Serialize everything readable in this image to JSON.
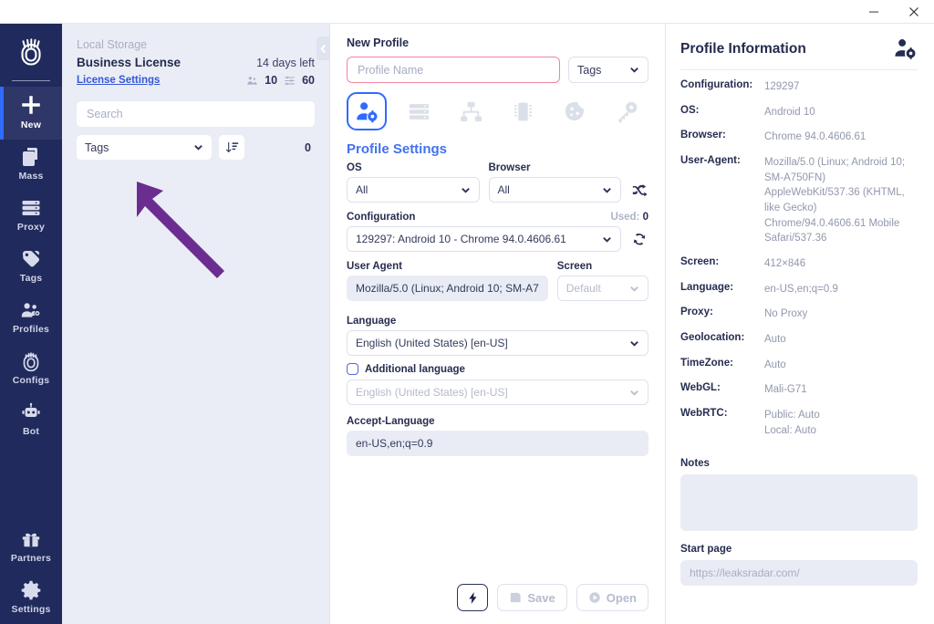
{
  "window": {
    "minimize_label": "minimize",
    "close_label": "close"
  },
  "sidebar": {
    "logo_name": "fingerprint-logo",
    "items": [
      {
        "label": "New",
        "icon": "plus-icon",
        "active": true
      },
      {
        "label": "Mass",
        "icon": "copy-icon",
        "active": false
      },
      {
        "label": "Proxy",
        "icon": "server-icon",
        "active": false
      },
      {
        "label": "Tags",
        "icon": "tag-icon",
        "active": false
      },
      {
        "label": "Profiles",
        "icon": "profiles-icon",
        "active": false
      },
      {
        "label": "Configs",
        "icon": "fingerprint-icon",
        "active": false
      },
      {
        "label": "Bot",
        "icon": "robot-icon",
        "active": false
      }
    ],
    "bottom_items": [
      {
        "label": "Partners",
        "icon": "gift-icon"
      },
      {
        "label": "Settings",
        "icon": "gear-icon"
      }
    ],
    "accent_color": "#2f6bff",
    "background_color": "#212a5c"
  },
  "list_panel": {
    "storage_label": "Local Storage",
    "license_name": "Business License",
    "days_left": "14 days left",
    "license_settings_link": "License Settings",
    "profiles_count": "10",
    "configs_count": "60",
    "search_placeholder": "Search",
    "tags_filter_label": "Tags",
    "sort_icon": "sort-descending-icon",
    "result_count": "0",
    "collapse_icon": "chevron-left-icon"
  },
  "annotation": {
    "type": "arrow",
    "color": "#6b2d8f",
    "points_to": "tags-filter-dropdown"
  },
  "center_panel": {
    "heading": "New Profile",
    "profile_name_placeholder": "Profile Name",
    "profile_name_value": "",
    "tags_label": "Tags",
    "tabs": [
      {
        "name": "profile-settings",
        "icon": "user-gear-icon",
        "active": true
      },
      {
        "name": "proxy",
        "icon": "server-icon",
        "active": false
      },
      {
        "name": "network",
        "icon": "sitemap-icon",
        "active": false
      },
      {
        "name": "hardware",
        "icon": "cpu-chip-icon",
        "active": false
      },
      {
        "name": "cookies",
        "icon": "cookie-icon",
        "active": false
      },
      {
        "name": "password",
        "icon": "key-icon",
        "active": false
      }
    ],
    "section_title": "Profile Settings",
    "os_label": "OS",
    "os_value": "All",
    "browser_label": "Browser",
    "browser_value": "All",
    "shuffle_icon": "shuffle-icon",
    "configuration_label": "Configuration",
    "used_label": "Used:",
    "used_value": "0",
    "configuration_value": "129297: Android 10 - Chrome 94.0.4606.61",
    "refresh_icon": "refresh-icon",
    "user_agent_label": "User Agent",
    "user_agent_value": "Mozilla/5.0 (Linux; Android 10; SM-A7",
    "screen_label": "Screen",
    "screen_value": "Default",
    "language_label": "Language",
    "language_value": "English (United States) [en-US]",
    "additional_language_label": "Additional language",
    "additional_language_value": "English (United States) [en-US]",
    "accept_language_label": "Accept-Language",
    "accept_language_value": "en-US,en;q=0.9",
    "flash_button_icon": "lightning-icon",
    "save_label": "Save",
    "open_label": "Open"
  },
  "right_panel": {
    "title": "Profile Information",
    "header_icon": "user-gear-icon",
    "info": [
      {
        "key": "Configuration:",
        "value": "129297"
      },
      {
        "key": "OS:",
        "value": "Android 10"
      },
      {
        "key": "Browser:",
        "value": "Chrome 94.0.4606.61"
      },
      {
        "key": "User-Agent:",
        "value": "Mozilla/5.0 (Linux; Android 10; SM-A750FN) AppleWebKit/537.36 (KHTML, like Gecko) Chrome/94.0.4606.61 Mobile Safari/537.36"
      },
      {
        "key": "Screen:",
        "value": "412×846"
      },
      {
        "key": "Language:",
        "value": "en-US,en;q=0.9"
      },
      {
        "key": "Proxy:",
        "value": "No Proxy"
      },
      {
        "key": "Geolocation:",
        "value": "Auto"
      },
      {
        "key": "TimeZone:",
        "value": "Auto"
      },
      {
        "key": "WebGL:",
        "value": "Mali-G71"
      },
      {
        "key": "WebRTC:",
        "value": "Public: Auto\nLocal:  Auto"
      }
    ],
    "notes_label": "Notes",
    "notes_value": "",
    "start_page_label": "Start page",
    "start_page_placeholder": "https://leaksradar.com/"
  }
}
